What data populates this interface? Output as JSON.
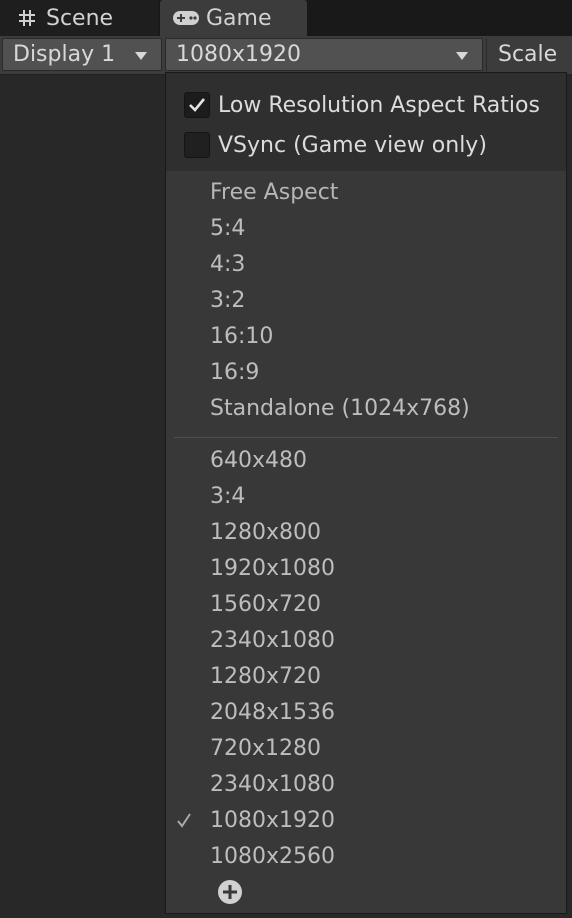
{
  "tabs": {
    "scene": {
      "label": "Scene",
      "icon": "grid-hash-icon"
    },
    "game": {
      "label": "Game",
      "icon": "gamepad-icon"
    }
  },
  "toolbar": {
    "display_value": "Display 1",
    "resolution_value": "1080x1920",
    "scale_label": "Scale"
  },
  "menu": {
    "options": [
      {
        "label": "Low Resolution Aspect Ratios",
        "checked": true
      },
      {
        "label": "VSync (Game view only)",
        "checked": false
      }
    ],
    "aspect_items": [
      "Free Aspect",
      "5:4",
      "4:3",
      "3:2",
      "16:10",
      "16:9",
      "Standalone (1024x768)"
    ],
    "resolution_items": [
      "640x480",
      "3:4",
      "1280x800",
      "1920x1080",
      "1560x720",
      "2340x1080",
      "1280x720",
      "2048x1536",
      "720x1280",
      "2340x1080",
      "1080x1920",
      "1080x2560"
    ],
    "selected_index": 10,
    "add_icon": "plus-circle-icon"
  },
  "colors": {
    "background": "#282828",
    "toolbar": "#3c3c3c",
    "menu": "#383838",
    "text": "#bdbdbd"
  }
}
